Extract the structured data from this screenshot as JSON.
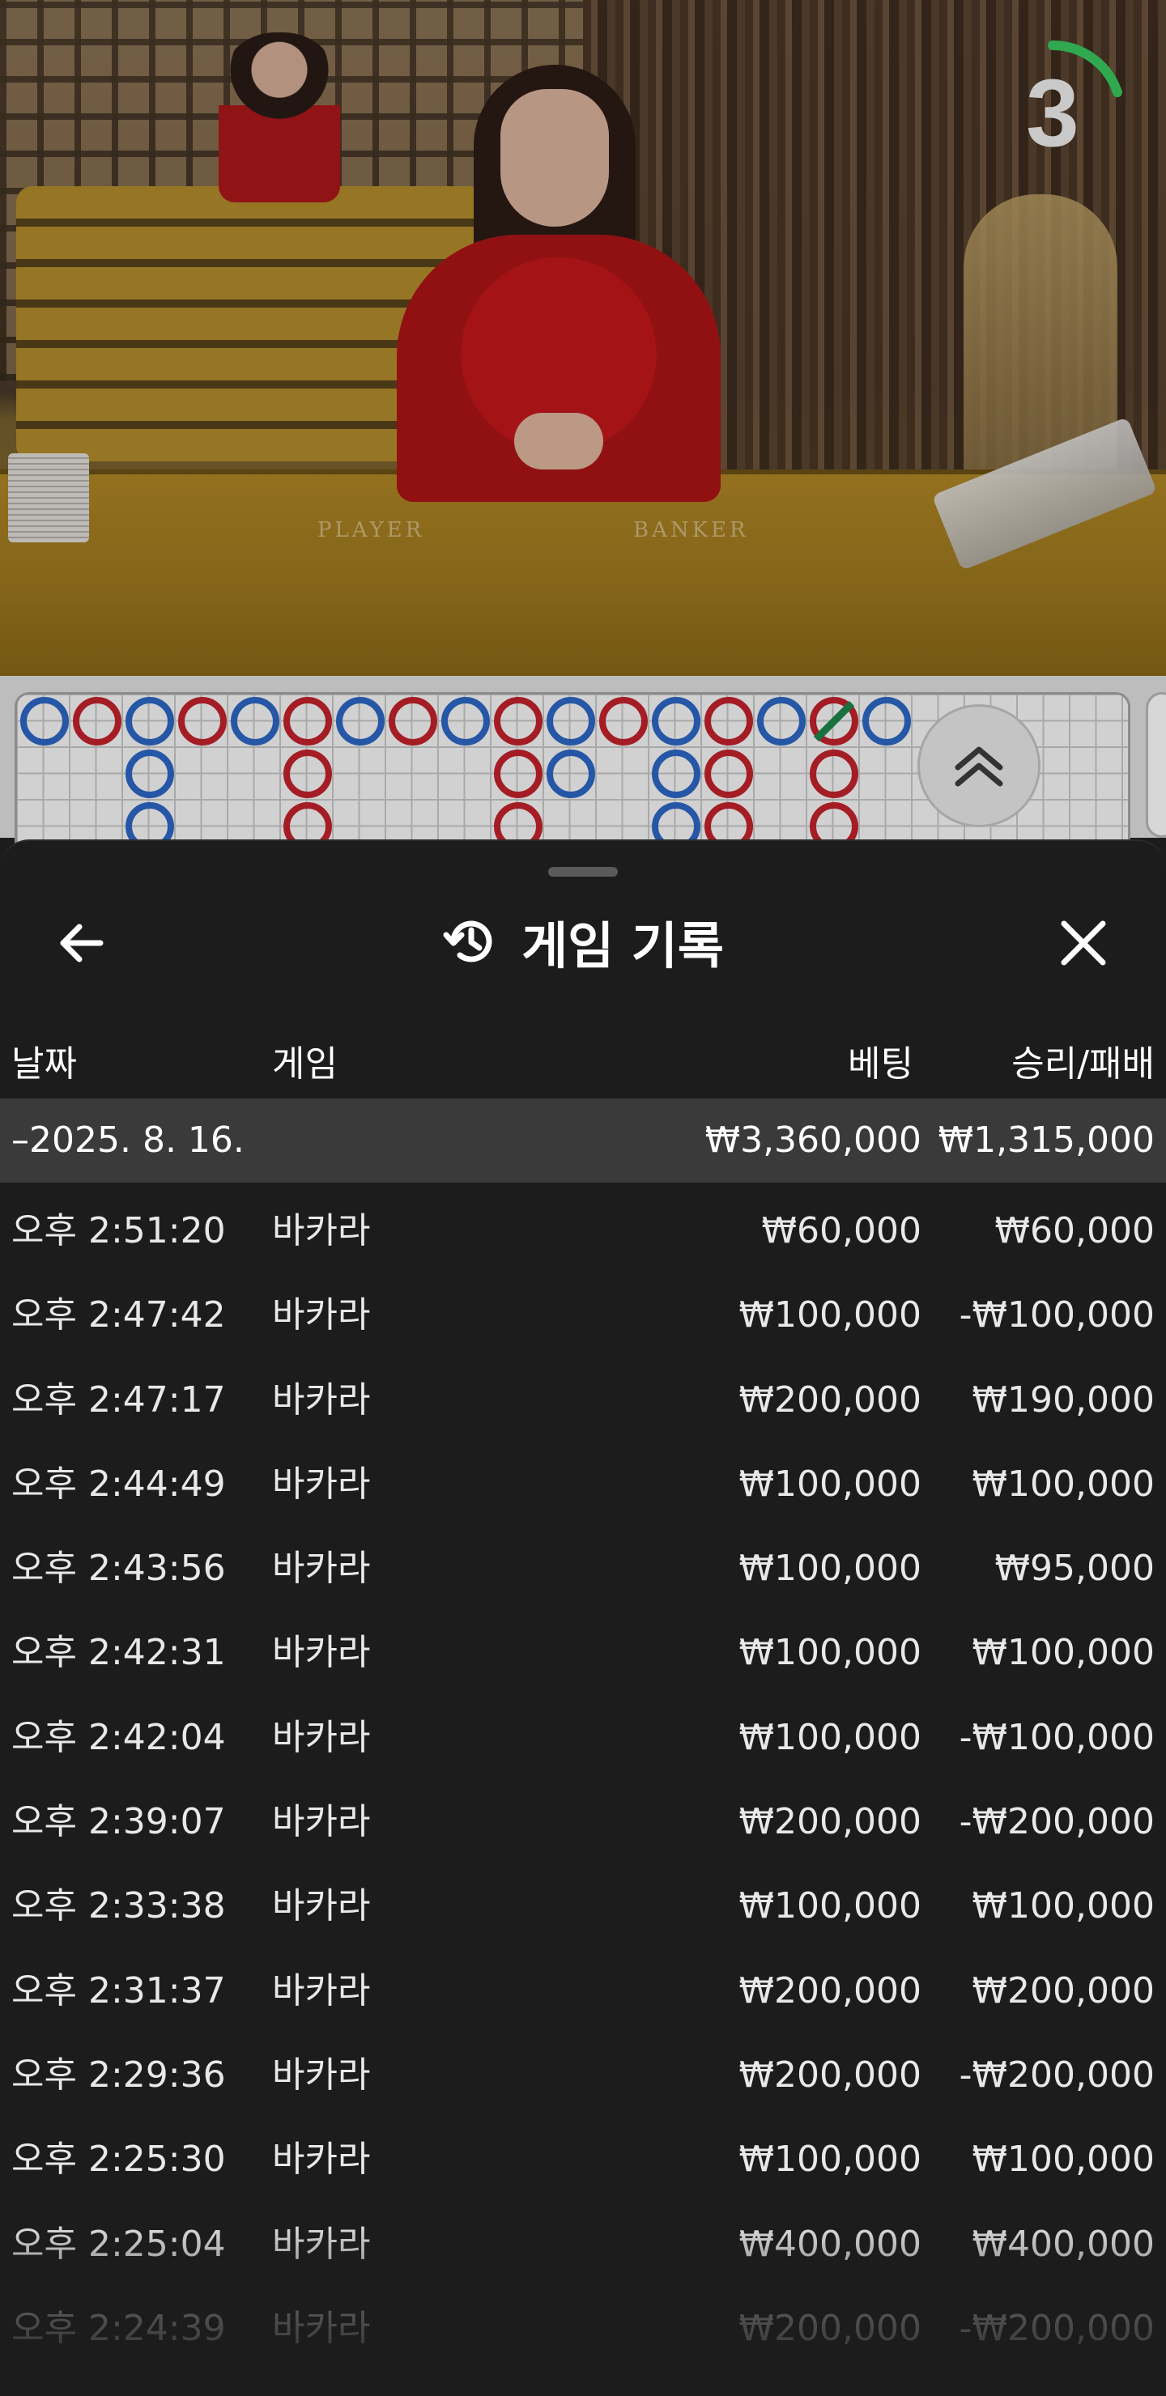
{
  "video": {
    "timer_value": "3",
    "timer_fraction": 0.2,
    "timer_color": "#2fa84f",
    "table_labels": {
      "player": "PLAYER",
      "banker": "BANKER"
    }
  },
  "roadmap": {
    "colors": {
      "banker": "#c9242e",
      "player": "#2f6bcb",
      "tie": "#1f8a4c"
    },
    "columns": [
      [
        "player"
      ],
      [
        "banker"
      ],
      [
        "player",
        "player",
        "player"
      ],
      [
        "banker"
      ],
      [
        "player"
      ],
      [
        "banker",
        "banker",
        "banker"
      ],
      [
        "player"
      ],
      [
        "banker"
      ],
      [
        "player"
      ],
      [
        "banker",
        "banker",
        "banker"
      ],
      [
        "player",
        "player"
      ],
      [
        "banker"
      ],
      [
        "player",
        "player",
        "player"
      ],
      [
        "banker",
        "banker",
        "banker"
      ],
      [
        "player"
      ],
      [
        "banker-tie",
        "banker",
        "banker"
      ],
      [
        "player"
      ]
    ]
  },
  "panel": {
    "title": "게임 기록",
    "icons": {
      "back": "back-arrow-icon",
      "history": "history-icon",
      "close": "close-icon"
    },
    "columns": {
      "date": "날짜",
      "game": "게임",
      "bet": "베팅",
      "win_loss": "승리/패배"
    },
    "date_group": {
      "date": "–2025. 8. 16.",
      "bet_total": "₩3,360,000",
      "win_loss_total": "₩1,315,000"
    },
    "rows": [
      {
        "time": "오후 2:51:20",
        "game": "바카라",
        "bet": "₩60,000",
        "result": "₩60,000"
      },
      {
        "time": "오후 2:47:42",
        "game": "바카라",
        "bet": "₩100,000",
        "result": "-₩100,000"
      },
      {
        "time": "오후 2:47:17",
        "game": "바카라",
        "bet": "₩200,000",
        "result": "₩190,000"
      },
      {
        "time": "오후 2:44:49",
        "game": "바카라",
        "bet": "₩100,000",
        "result": "₩100,000"
      },
      {
        "time": "오후 2:43:56",
        "game": "바카라",
        "bet": "₩100,000",
        "result": "₩95,000"
      },
      {
        "time": "오후 2:42:31",
        "game": "바카라",
        "bet": "₩100,000",
        "result": "₩100,000"
      },
      {
        "time": "오후 2:42:04",
        "game": "바카라",
        "bet": "₩100,000",
        "result": "-₩100,000"
      },
      {
        "time": "오후 2:39:07",
        "game": "바카라",
        "bet": "₩200,000",
        "result": "-₩200,000"
      },
      {
        "time": "오후 2:33:38",
        "game": "바카라",
        "bet": "₩100,000",
        "result": "₩100,000"
      },
      {
        "time": "오후 2:31:37",
        "game": "바카라",
        "bet": "₩200,000",
        "result": "₩200,000"
      },
      {
        "time": "오후 2:29:36",
        "game": "바카라",
        "bet": "₩200,000",
        "result": "-₩200,000"
      },
      {
        "time": "오후 2:25:30",
        "game": "바카라",
        "bet": "₩100,000",
        "result": "₩100,000"
      },
      {
        "time": "오후 2:25:04",
        "game": "바카라",
        "bet": "₩400,000",
        "result": "₩400,000"
      },
      {
        "time": "오후 2:24:39",
        "game": "바카라",
        "bet": "₩200,000",
        "result": "-₩200,000"
      }
    ]
  }
}
